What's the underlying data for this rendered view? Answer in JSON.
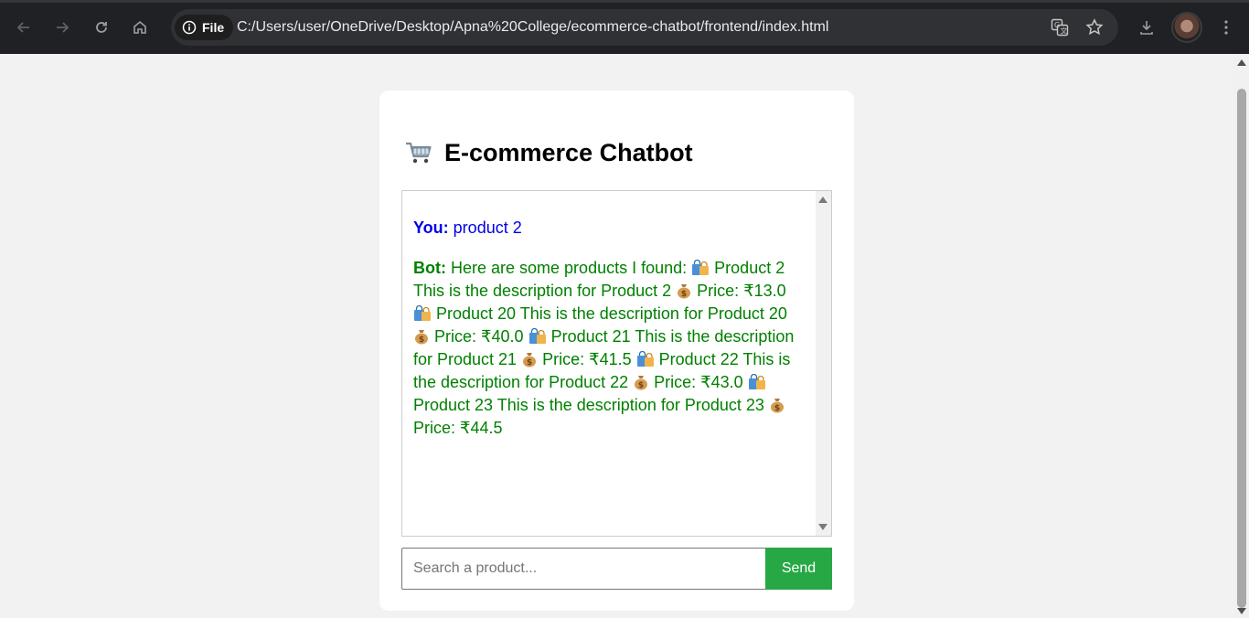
{
  "browser": {
    "file_label": "File",
    "url": "C:/Users/user/OneDrive/Desktop/Apna%20College/ecommerce-chatbot/frontend/index.html"
  },
  "app": {
    "title": "E-commerce Chatbot",
    "icon": "shopping-cart-icon"
  },
  "chat": {
    "user_label": "You:",
    "user_text": "product 2",
    "bot_label": "Bot:",
    "bot_intro": "Here are some products I found:",
    "products": [
      {
        "name": "Product 2",
        "description": "This is the description for Product 2",
        "price_label": "Price:",
        "price": "₹13.0"
      },
      {
        "name": "Product 20",
        "description": "This is the description for Product 20",
        "price_label": "Price:",
        "price": "₹40.0"
      },
      {
        "name": "Product 21",
        "description": "This is the description for Product 21",
        "price_label": "Price:",
        "price": "₹41.5"
      },
      {
        "name": "Product 22",
        "description": "This is the description for Product 22",
        "price_label": "Price:",
        "price": "₹43.0"
      },
      {
        "name": "Product 23",
        "description": "This is the description for Product 23",
        "price_label": "Price:",
        "price": "₹44.5"
      }
    ],
    "product_icon": "shopping-bags-icon",
    "price_icon": "money-bag-icon"
  },
  "input": {
    "placeholder": "Search a product...",
    "value": ""
  },
  "send_button": {
    "label": "Send"
  },
  "colors": {
    "user": "#0000e6",
    "bot": "#008000",
    "send": "#28a745",
    "page_bg": "#f2f2f2"
  }
}
